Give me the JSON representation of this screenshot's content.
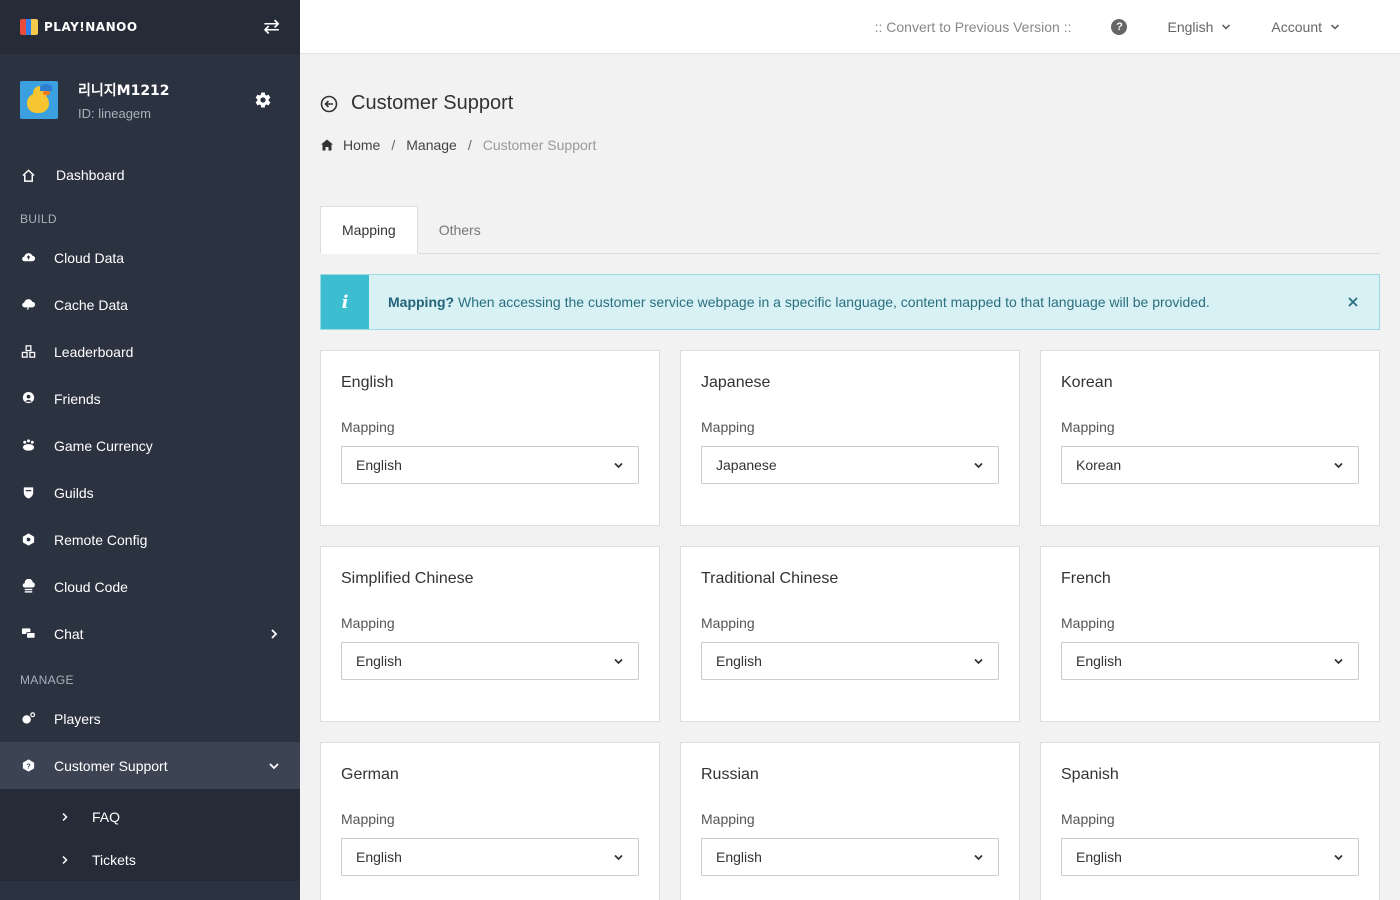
{
  "brand": {
    "logo_text": "PLAY!NANOO",
    "logo_colors": [
      "#e94b3c",
      "#2f80ed",
      "#f2c94c"
    ]
  },
  "profile": {
    "name": "리니지M1212",
    "id": "ID: lineagem"
  },
  "sidebar": {
    "dashboard": "Dashboard",
    "build_label": "BUILD",
    "build_items": [
      "Cloud Data",
      "Cache Data",
      "Leaderboard",
      "Friends",
      "Game Currency",
      "Guilds",
      "Remote Config",
      "Cloud Code",
      "Chat"
    ],
    "manage_label": "MANAGE",
    "manage_items": [
      "Players",
      "Customer Support"
    ],
    "sub_items": [
      "FAQ",
      "Tickets"
    ]
  },
  "topbar": {
    "convert": ":: Convert to Previous Version ::",
    "help": "?",
    "language": "English",
    "account": "Account"
  },
  "page": {
    "title": "Customer Support",
    "breadcrumb": [
      "Home",
      "Manage",
      "Customer Support"
    ],
    "tabs": [
      "Mapping",
      "Others"
    ]
  },
  "alert": {
    "icon": "i",
    "title": "Mapping?",
    "text": " When accessing the customer service webpage in a specific language, content mapped to that language will be provided."
  },
  "mapping_label": "Mapping",
  "cards": [
    {
      "title": "English",
      "value": "English"
    },
    {
      "title": "Japanese",
      "value": "Japanese"
    },
    {
      "title": "Korean",
      "value": "Korean"
    },
    {
      "title": "Simplified Chinese",
      "value": "English"
    },
    {
      "title": "Traditional Chinese",
      "value": "English"
    },
    {
      "title": "French",
      "value": "English"
    },
    {
      "title": "German",
      "value": "English"
    },
    {
      "title": "Russian",
      "value": "English"
    },
    {
      "title": "Spanish",
      "value": "English"
    }
  ],
  "colors": {
    "sidebar": "#2b3240",
    "active": "#3c4454",
    "alert_accent": "#3cbdd0"
  }
}
